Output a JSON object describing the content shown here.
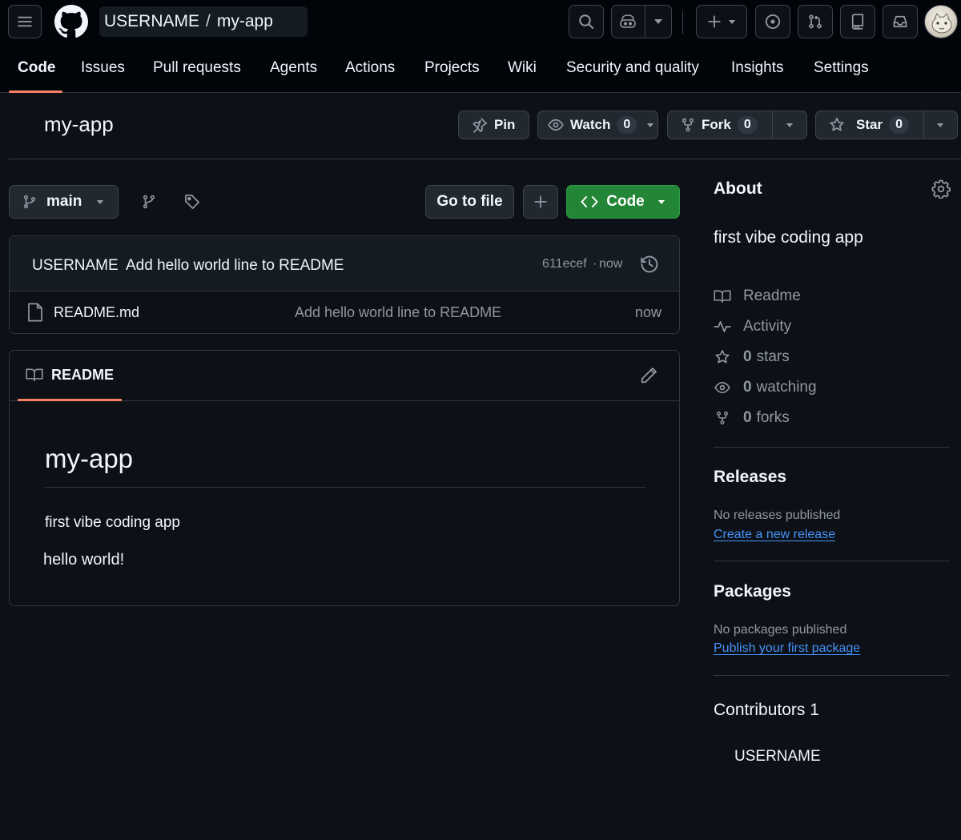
{
  "header": {
    "owner": "USERNAME",
    "separator": "/",
    "repo": "my-app"
  },
  "tabs": [
    {
      "label": "Code",
      "active": true
    },
    {
      "label": "Issues"
    },
    {
      "label": "Pull requests"
    },
    {
      "label": "Agents"
    },
    {
      "label": "Actions"
    },
    {
      "label": "Projects"
    },
    {
      "label": "Wiki"
    },
    {
      "label": "Security and quality"
    },
    {
      "label": "Insights"
    },
    {
      "label": "Settings"
    }
  ],
  "repo_header": {
    "title": "my-app",
    "pin_label": "Pin",
    "watch_label": "Watch",
    "watch_count": "0",
    "fork_label": "Fork",
    "fork_count": "0",
    "star_label": "Star",
    "star_count": "0"
  },
  "browser": {
    "branch": "main",
    "go_to_file": "Go to file",
    "code_label": "Code",
    "commit": {
      "author": "USERNAME",
      "message": "Add hello world line to README",
      "sha": "611ecef",
      "dot": "·",
      "time": "now"
    },
    "files": [
      {
        "name": "README.md",
        "message": "Add hello world line to README",
        "time": "now"
      }
    ]
  },
  "readme": {
    "tab_label": "README",
    "heading": "my-app",
    "paragraph1": "first vibe coding app",
    "paragraph2": "hello world!"
  },
  "about": {
    "heading": "About",
    "description": "first vibe coding app",
    "items": [
      {
        "icon": "book-icon",
        "label": "Readme"
      },
      {
        "icon": "pulse-icon",
        "label": "Activity"
      },
      {
        "icon": "star-icon",
        "count": "0",
        "label": "stars"
      },
      {
        "icon": "eye-icon",
        "count": "0",
        "label": "watching"
      },
      {
        "icon": "fork-icon",
        "count": "0",
        "label": "forks"
      }
    ]
  },
  "releases": {
    "heading": "Releases",
    "empty": "No releases published",
    "link": "Create a new release"
  },
  "packages": {
    "heading": "Packages",
    "empty": "No packages published",
    "link": "Publish your first package"
  },
  "contributors": {
    "heading": "Contributors",
    "count": "1",
    "users": [
      "USERNAME"
    ]
  },
  "colors": {
    "background": "#0d1117",
    "header_bg": "#010409",
    "accent_tab": "#f78166",
    "primary_button": "#238636",
    "link": "#4493f8"
  }
}
